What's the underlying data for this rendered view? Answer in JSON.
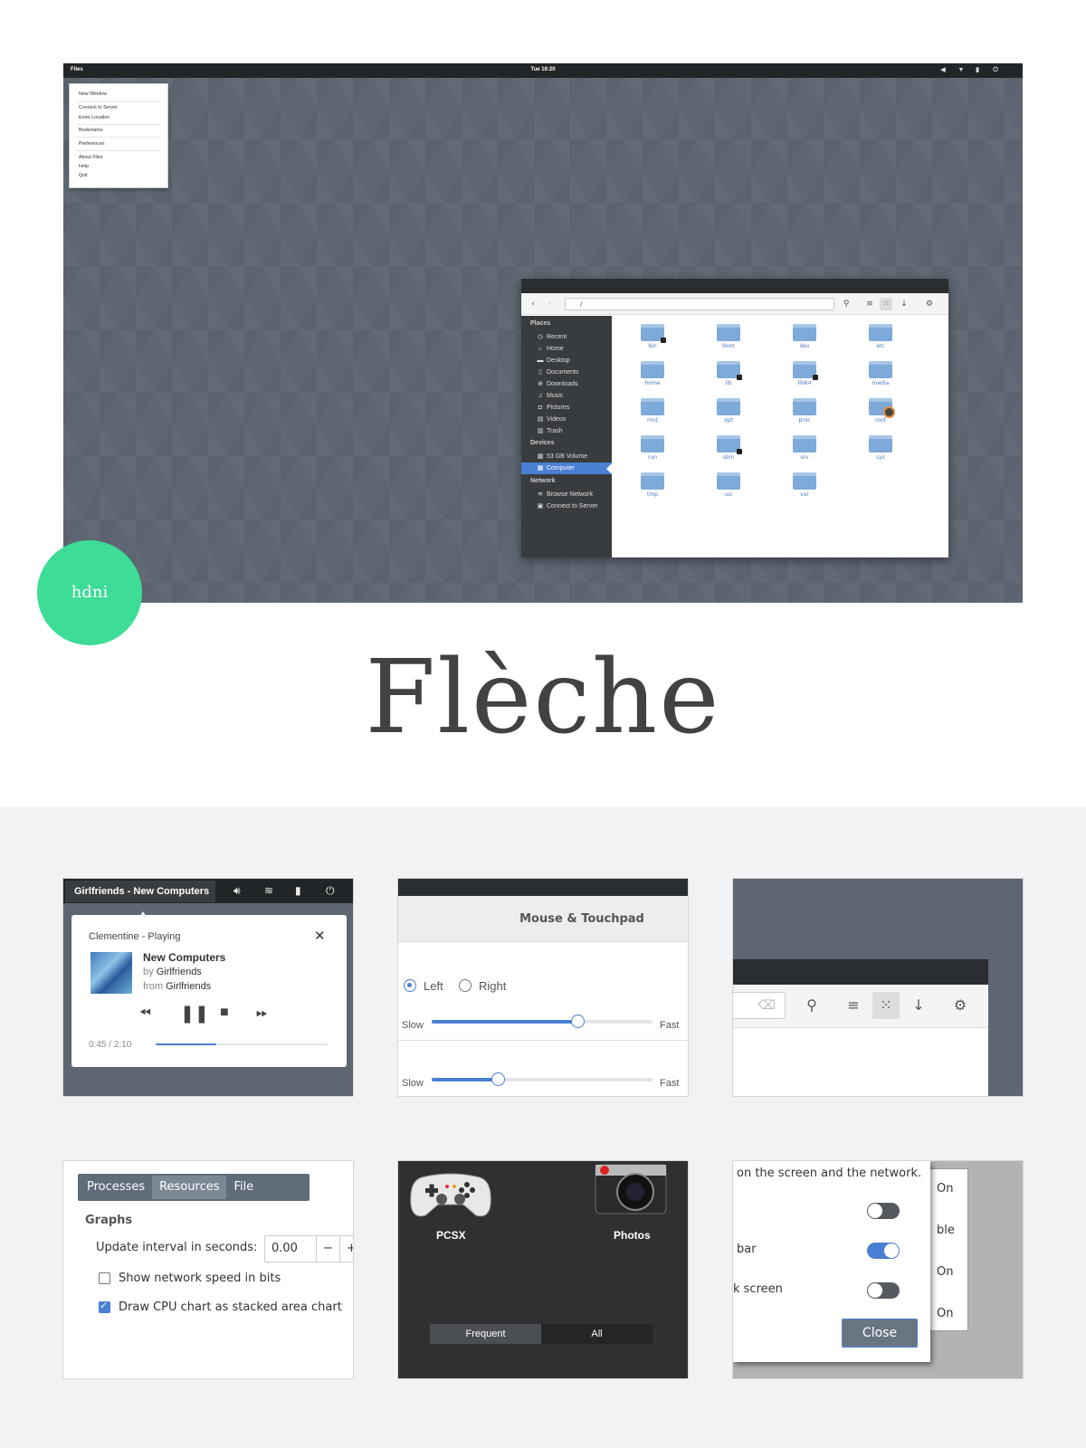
{
  "desktop": {
    "topbar": {
      "app_menu": "Files",
      "clock": "Tue 16:20"
    },
    "app_menu_items": [
      "New Window",
      "Connect to Server",
      "Enter Location",
      "Bookmarks",
      "Preferences",
      "About Files",
      "Help",
      "Quit"
    ],
    "file_manager": {
      "location": "/",
      "sidebar": {
        "places_header": "Places",
        "places": [
          "Recent",
          "Home",
          "Desktop",
          "Documents",
          "Downloads",
          "Music",
          "Pictures",
          "Videos",
          "Trash"
        ],
        "devices_header": "Devices",
        "devices": [
          "53 GB Volume",
          "Computer"
        ],
        "network_header": "Network",
        "network": [
          "Browse Network",
          "Connect to Server"
        ]
      },
      "folders": [
        "bin",
        "boot",
        "dev",
        "etc",
        "home",
        "lib",
        "lib64",
        "media",
        "mnt",
        "opt",
        "proc",
        "root",
        "run",
        "sbin",
        "srv",
        "sys",
        "tmp",
        "usr",
        "var"
      ]
    }
  },
  "badge": "hdni",
  "title": "Flèche",
  "media": {
    "now_playing": "Girlfriends - New Computers",
    "player": "Clementine - Playing",
    "track": "New Computers",
    "by_prefix": "by",
    "artist": "Girlfriends",
    "from_prefix": "from",
    "album": "Girlfriends",
    "time": "0:45 / 2:10",
    "progress": 0.35
  },
  "mouse": {
    "title": "Mouse & Touchpad",
    "left": "Left",
    "right": "Right",
    "slow": "Slow",
    "fast": "Fast",
    "speed1": 0.66,
    "speed2": 0.3
  },
  "monitor": {
    "tabs": [
      "Processes",
      "Resources",
      "File Systems"
    ],
    "graphs": "Graphs",
    "interval_label": "Update interval in seconds:",
    "interval_value": "0.00",
    "minus": "−",
    "plus": "+",
    "opt1": "Show network speed in bits",
    "opt2": "Draw CPU chart as stacked area chart"
  },
  "launcher": {
    "app1": "PCSX",
    "app2": "Photos",
    "frequent": "Frequent",
    "all": "All"
  },
  "privacy": {
    "line1": "on the screen and the network.",
    "row2": "bar",
    "row3": "k screen",
    "close": "Close",
    "side": [
      "On",
      "ble",
      "On",
      "On"
    ]
  }
}
